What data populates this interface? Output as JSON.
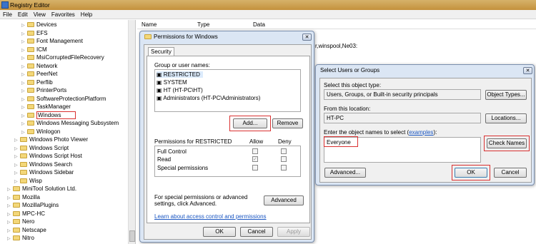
{
  "window": {
    "title": "Registry Editor"
  },
  "menu": [
    "File",
    "Edit",
    "View",
    "Favorites",
    "Help"
  ],
  "list_columns": {
    "name": "Name",
    "type": "Type",
    "data": "Data"
  },
  "background_data_text": "r,winspool,Ne03:",
  "tree": [
    {
      "label": "Devices",
      "indent": 3
    },
    {
      "label": "EFS",
      "indent": 3
    },
    {
      "label": "Font Management",
      "indent": 3
    },
    {
      "label": "ICM",
      "indent": 3
    },
    {
      "label": "MsiCorruptedFileRecovery",
      "indent": 3
    },
    {
      "label": "Network",
      "indent": 3
    },
    {
      "label": "PeerNet",
      "indent": 3
    },
    {
      "label": "Perflib",
      "indent": 3
    },
    {
      "label": "PrinterPorts",
      "indent": 3
    },
    {
      "label": "SoftwareProtectionPlatform",
      "indent": 3
    },
    {
      "label": "TaskManager",
      "indent": 3
    },
    {
      "label": "Windows",
      "indent": 3,
      "selected": true
    },
    {
      "label": "Windows Messaging Subsystem",
      "indent": 3
    },
    {
      "label": "Winlogon",
      "indent": 3
    },
    {
      "label": "Windows Photo Viewer",
      "indent": 2
    },
    {
      "label": "Windows Script",
      "indent": 2
    },
    {
      "label": "Windows Script Host",
      "indent": 2
    },
    {
      "label": "Windows Search",
      "indent": 2
    },
    {
      "label": "Windows Sidebar",
      "indent": 2
    },
    {
      "label": "Wisp",
      "indent": 2
    },
    {
      "label": "MiniTool Solution Ltd.",
      "indent": 1
    },
    {
      "label": "Mozilla",
      "indent": 1
    },
    {
      "label": "MozillaPlugins",
      "indent": 1
    },
    {
      "label": "MPC-HC",
      "indent": 1
    },
    {
      "label": "Nero",
      "indent": 1
    },
    {
      "label": "Netscape",
      "indent": 1
    },
    {
      "label": "Nitro",
      "indent": 1
    }
  ],
  "permissions": {
    "title": "Permissions for Windows",
    "tab": "Security",
    "group_label": "Group or user names:",
    "users": [
      "RESTRICTED",
      "SYSTEM",
      "HT (HT-PC\\HT)",
      "Administrators (HT-PC\\Administrators)"
    ],
    "add_label": "Add...",
    "remove_label": "Remove",
    "perm_header": "Permissions for RESTRICTED",
    "allow": "Allow",
    "deny": "Deny",
    "perm_rows": [
      {
        "name": "Full Control",
        "allow": false,
        "deny": false
      },
      {
        "name": "Read",
        "allow": true,
        "deny": false
      },
      {
        "name": "Special permissions",
        "allow": false,
        "deny": false
      }
    ],
    "advanced_text": "For special permissions or advanced settings, click Advanced.",
    "advanced_label": "Advanced",
    "learn_link": "Learn about access control and permissions",
    "ok": "OK",
    "cancel": "Cancel",
    "apply": "Apply"
  },
  "select_users": {
    "title": "Select Users or Groups",
    "object_type_label": "Select this object type:",
    "object_type_value": "Users, Groups, or Built-in security principals",
    "object_types_button": "Object Types...",
    "location_label": "From this location:",
    "location_value": "HT-PC",
    "locations_button": "Locations...",
    "enter_label": "Enter the object names to select",
    "examples_link": "examples",
    "enter_value": "Everyone",
    "check_names": "Check Names",
    "advanced": "Advanced...",
    "ok": "OK",
    "cancel": "Cancel"
  }
}
